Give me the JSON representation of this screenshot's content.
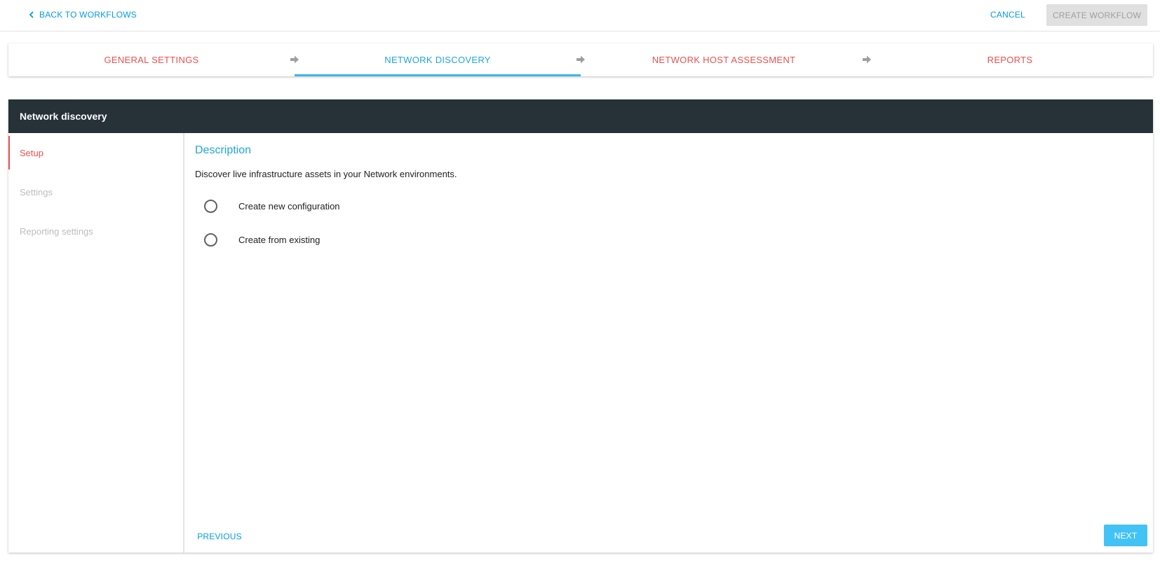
{
  "topbar": {
    "back_label": "BACK TO WORKFLOWS",
    "cancel_label": "CANCEL",
    "create_label": "CREATE WORKFLOW"
  },
  "stepper": {
    "steps": [
      {
        "label": "GENERAL SETTINGS",
        "state": "completed"
      },
      {
        "label": "NETWORK DISCOVERY",
        "state": "active"
      },
      {
        "label": "NETWORK HOST ASSESSMENT",
        "state": "completed"
      },
      {
        "label": "REPORTS",
        "state": "completed"
      }
    ]
  },
  "panel": {
    "title": "Network discovery",
    "sidebar": {
      "items": [
        {
          "label": "Setup",
          "state": "active"
        },
        {
          "label": "Settings",
          "state": "disabled"
        },
        {
          "label": "Reporting settings",
          "state": "disabled"
        }
      ]
    },
    "content": {
      "description_title": "Description",
      "description_text": "Discover live infrastructure assets in your Network environments.",
      "options": [
        {
          "label": "Create new configuration",
          "selected": false
        },
        {
          "label": "Create from existing",
          "selected": false
        }
      ],
      "previous_label": "PREVIOUS",
      "next_label": "NEXT"
    }
  },
  "colors": {
    "accent_blue": "#1ea6dc",
    "link_blue": "#039be5",
    "completed_red": "#e8514f",
    "header_dark": "#263238",
    "next_button": "#43c3f5",
    "disabled_button": "#e0e0e0"
  }
}
